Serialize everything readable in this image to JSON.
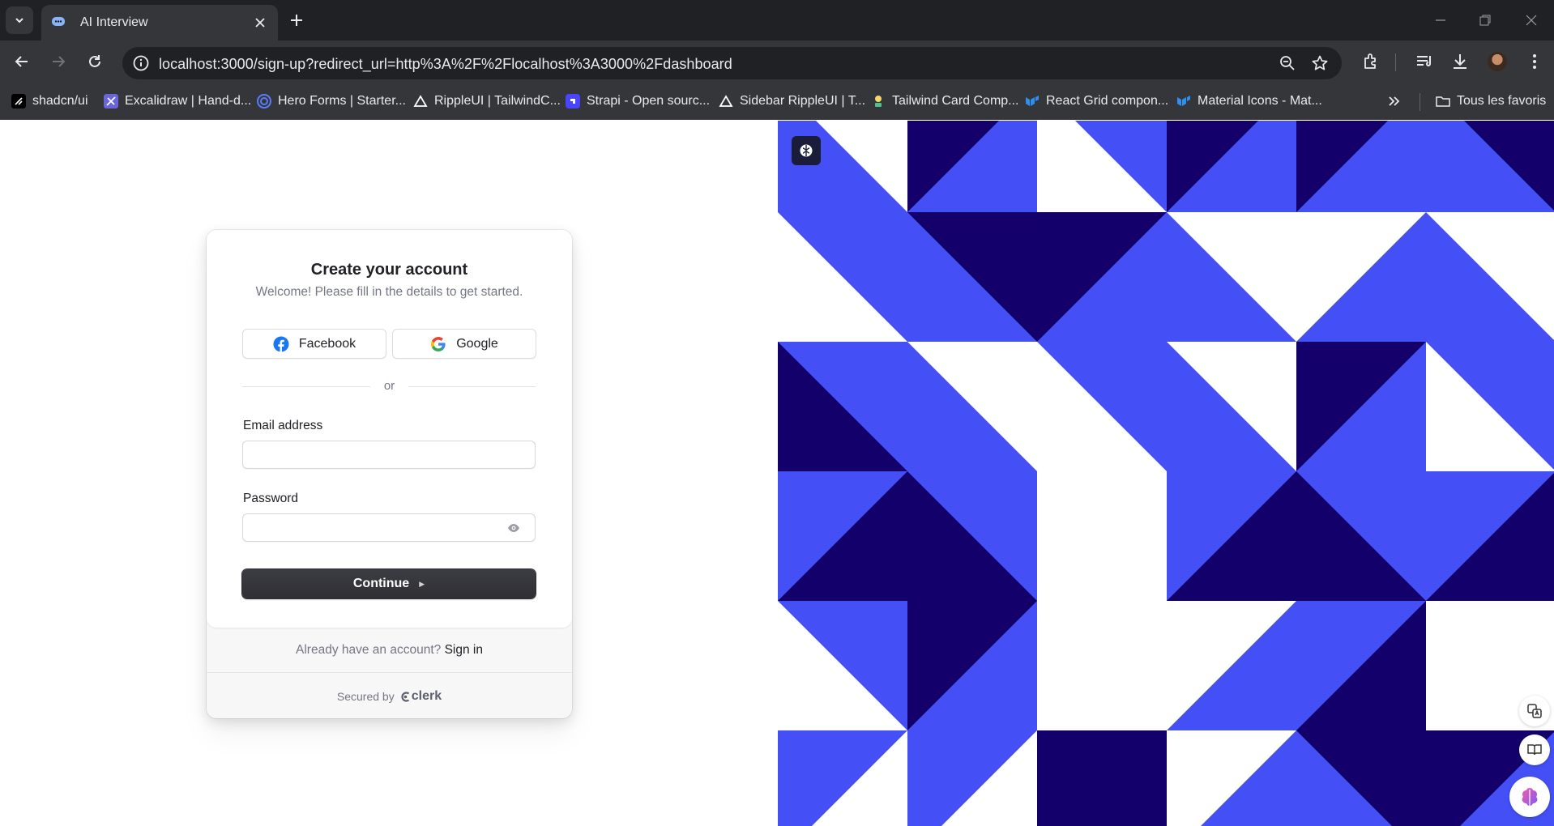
{
  "browser": {
    "tab_title": "AI Interview",
    "url": "localhost:3000/sign-up?redirect_url=http%3A%2F%2Flocalhost%3A3000%2Fdashboard",
    "bookmarks": [
      {
        "label": "shadcn/ui",
        "icon": "shadcn-icon"
      },
      {
        "label": "Excalidraw | Hand-d...",
        "icon": "excalidraw-icon"
      },
      {
        "label": "Hero Forms | Starter...",
        "icon": "heroforms-icon"
      },
      {
        "label": "RippleUI | TailwindC...",
        "icon": "rippleui-icon"
      },
      {
        "label": "Strapi - Open sourc...",
        "icon": "strapi-icon"
      },
      {
        "label": "Sidebar RippleUI | T...",
        "icon": "rippleui-icon"
      },
      {
        "label": "Tailwind Card Comp...",
        "icon": "tailwind-card-icon"
      },
      {
        "label": "React Grid compon...",
        "icon": "mui-icon"
      },
      {
        "label": "Material Icons - Mat...",
        "icon": "mui-icon"
      }
    ],
    "all_bookmarks_label": "Tous les favoris"
  },
  "signup": {
    "title": "Create your account",
    "subtitle": "Welcome! Please fill in the details to get started.",
    "facebook_label": "Facebook",
    "google_label": "Google",
    "divider_text": "or",
    "email_label": "Email address",
    "email_value": "",
    "password_label": "Password",
    "password_value": "",
    "continue_label": "Continue",
    "signin_prompt": "Already have an account?",
    "signin_link": "Sign in",
    "secured_by": "Secured by",
    "clerk_brand": "clerk"
  },
  "colors": {
    "pattern_blue": "#4450f5",
    "pattern_navy": "#13006a",
    "button_dark": "#2f3037",
    "browser_dark": "#202124",
    "browser_toolbar": "#35363a"
  }
}
